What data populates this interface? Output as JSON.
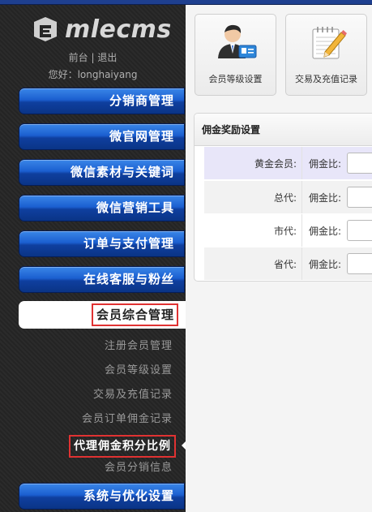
{
  "app": {
    "logo_text": "mlecms"
  },
  "header": {
    "link_front": "前台",
    "separator": "|",
    "link_logout": "退出",
    "greeting": "您好：longhaiyang"
  },
  "sidebar": {
    "menu": [
      "分销商管理",
      "微官网管理",
      "微信素材与关键词",
      "微信营销工具",
      "订单与支付管理",
      "在线客服与粉丝"
    ],
    "active_menu": "会员综合管理",
    "sub_items": [
      "注册会员管理",
      "会员等级设置",
      "交易及充值记录",
      "会员订单佣金记录",
      "代理佣金积分比例",
      "会员分销信息"
    ],
    "active_sub_index": 4,
    "bottom_menu": "系统与优化设置"
  },
  "main": {
    "tiles": [
      {
        "label": "会员等级设置",
        "icon": "user-card-icon"
      },
      {
        "label": "交易及充值记录",
        "icon": "notepad-pencil-icon"
      }
    ],
    "panel": {
      "title": "佣金奖励设置",
      "rows": [
        {
          "level": "黄金会员:",
          "ratio_label": "佣金比:",
          "value": ""
        },
        {
          "level": "总代:",
          "ratio_label": "佣金比:",
          "value": ""
        },
        {
          "level": "市代:",
          "ratio_label": "佣金比:",
          "value": ""
        },
        {
          "level": "省代:",
          "ratio_label": "佣金比:",
          "value": ""
        }
      ]
    }
  },
  "colors": {
    "nav_blue": "#1b5fd0",
    "highlight_red": "#e03232",
    "row_highlight": "#e8e6f9",
    "row_alt": "#f2f2f2"
  }
}
